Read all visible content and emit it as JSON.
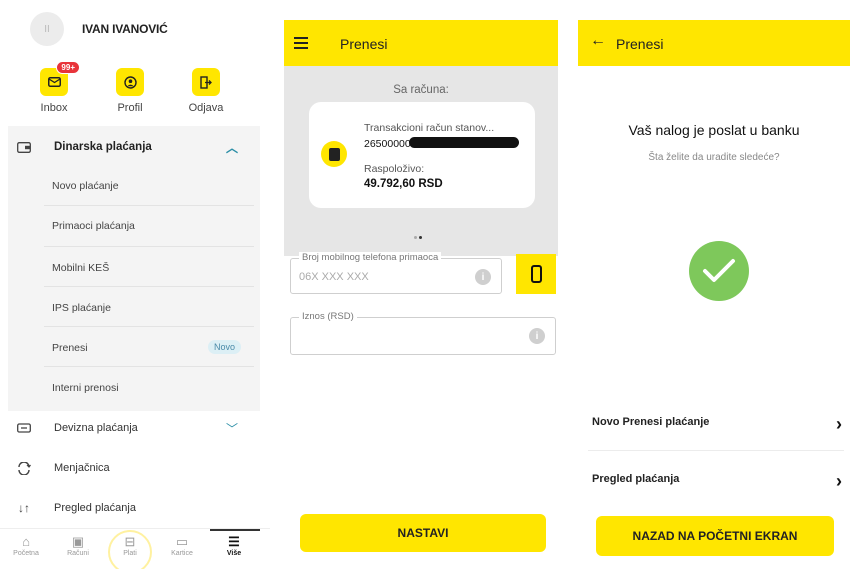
{
  "menu": {
    "user_initials": "II",
    "user_name": "IVAN IVANOVIĆ",
    "quick_actions": [
      {
        "label": "Inbox",
        "icon": "mail-icon",
        "badge": "99+"
      },
      {
        "label": "Profil",
        "icon": "profile-icon"
      },
      {
        "label": "Odjava",
        "icon": "logout-icon"
      }
    ],
    "section_dinarska": "Dinarska plaćanja",
    "sub_items": [
      "Novo plaćanje",
      "Primaoci plaćanja",
      "Mobilni KEŠ",
      "IPS plaćanje",
      "Prenesi",
      "Interni prenosi"
    ],
    "novo_badge": "Novo",
    "other_items": [
      "Devizna plaćanja",
      "Menjačnica",
      "Pregled plaćanja"
    ],
    "nav": [
      "Početna",
      "Računi",
      "Plati",
      "Kartice",
      "Više"
    ]
  },
  "form": {
    "title": "Prenesi",
    "from_label": "Sa računa:",
    "account_name": "Transakcioni račun stanov...",
    "account_number": "265000000",
    "available_label": "Raspoloživo:",
    "available_amount": "49.792,60 RSD",
    "phone_label": "Broj mobilnog telefona primaoca",
    "phone_placeholder": "06X XXX XXX",
    "amount_label": "Iznos (RSD)",
    "amount_value": "",
    "continue_button": "NASTAVI"
  },
  "success": {
    "title": "Prenesi",
    "heading": "Vaš nalog je poslat u banku",
    "subheading": "Šta želite da uradite sledeće?",
    "link1": "Novo Prenesi plaćanje",
    "link2": "Pregled plaćanja",
    "home_button": "NAZAD NA POČETNI EKRAN"
  },
  "colors": {
    "brand": "#ffe600",
    "success": "#7ec85b",
    "badge": "#e8343a"
  }
}
